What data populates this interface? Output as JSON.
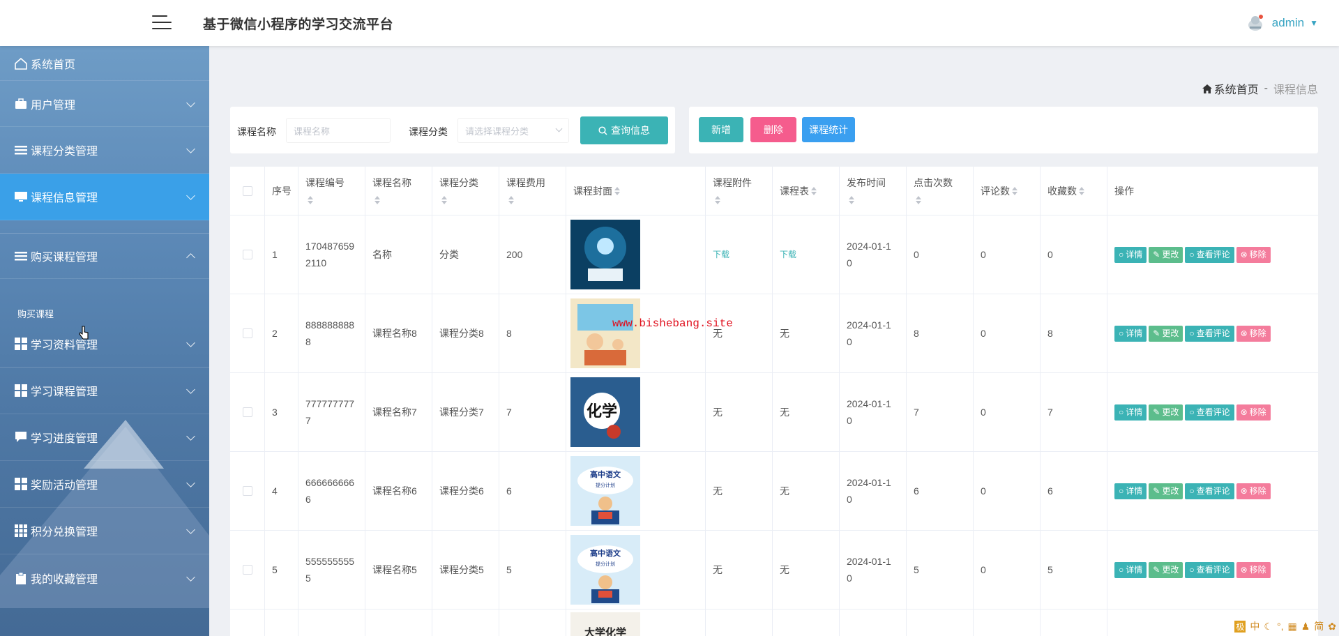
{
  "header": {
    "title": "基于微信小程序的学习交流平台",
    "username": "admin"
  },
  "sidebar": {
    "items": [
      {
        "label": "系统首页",
        "icon": "home-icon"
      },
      {
        "label": "用户管理",
        "icon": "briefcase-icon"
      },
      {
        "label": "课程分类管理",
        "icon": "list-icon"
      },
      {
        "label": "课程信息管理",
        "icon": "monitor-icon"
      },
      {
        "label": "购买课程管理",
        "icon": "list-icon"
      },
      {
        "label": "学习资料管理",
        "icon": "grid-icon"
      },
      {
        "label": "学习课程管理",
        "icon": "grid-icon"
      },
      {
        "label": "学习进度管理",
        "icon": "chat-icon"
      },
      {
        "label": "奖励活动管理",
        "icon": "grid-icon"
      },
      {
        "label": "积分兑换管理",
        "icon": "grid9-icon"
      },
      {
        "label": "我的收藏管理",
        "icon": "clipboard-icon"
      }
    ],
    "sub_item": "购买课程"
  },
  "breadcrumb": {
    "home": "系统首页",
    "separator": "-",
    "current": "课程信息"
  },
  "search": {
    "name_label": "课程名称",
    "name_placeholder": "课程名称",
    "category_label": "课程分类",
    "category_placeholder": "请选择课程分类",
    "button": "查询信息"
  },
  "actions": {
    "add": "新增",
    "delete": "删除",
    "stats": "课程统计"
  },
  "table": {
    "headers": [
      "序号",
      "课程编号",
      "课程名称",
      "课程分类",
      "课程费用",
      "课程封面",
      "课程附件",
      "课程表",
      "发布时间",
      "点击次数",
      "评论数",
      "收藏数",
      "操作"
    ],
    "rows": [
      {
        "idx": "1",
        "code1": "170487659",
        "code2": "2110",
        "name": "名称",
        "category": "分类",
        "fee": "200",
        "cover": "cover-1",
        "attachment": "下载",
        "schedule": "下载",
        "date1": "2024-01-1",
        "date2": "0",
        "clicks": "0",
        "comments": "0",
        "favorites": "0"
      },
      {
        "idx": "2",
        "code1": "888888888",
        "code2": "8",
        "name": "课程名称8",
        "category": "课程分类8",
        "fee": "8",
        "cover": "cover-2",
        "attachment": "无",
        "schedule": "无",
        "date1": "2024-01-1",
        "date2": "0",
        "clicks": "8",
        "comments": "0",
        "favorites": "8"
      },
      {
        "idx": "3",
        "code1": "777777777",
        "code2": "7",
        "name": "课程名称7",
        "category": "课程分类7",
        "fee": "7",
        "cover": "cover-3",
        "cover_text": "化学",
        "attachment": "无",
        "schedule": "无",
        "date1": "2024-01-1",
        "date2": "0",
        "clicks": "7",
        "comments": "0",
        "favorites": "7"
      },
      {
        "idx": "4",
        "code1": "666666666",
        "code2": "6",
        "name": "课程名称6",
        "category": "课程分类6",
        "fee": "6",
        "cover": "cover-4",
        "cover_text": "高中语文",
        "cover_sub": "提分计划",
        "attachment": "无",
        "schedule": "无",
        "date1": "2024-01-1",
        "date2": "0",
        "clicks": "6",
        "comments": "0",
        "favorites": "6"
      },
      {
        "idx": "5",
        "code1": "555555555",
        "code2": "5",
        "name": "课程名称5",
        "category": "课程分类5",
        "fee": "5",
        "cover": "cover-5",
        "cover_text": "高中语文",
        "cover_sub": "提分计划",
        "attachment": "无",
        "schedule": "无",
        "date1": "2024-01-1",
        "date2": "0",
        "clicks": "5",
        "comments": "0",
        "favorites": "5"
      }
    ],
    "partial_cover_text": "大学化学",
    "ops": {
      "detail": "详情",
      "edit": "更改",
      "comments": "查看评论",
      "remove": "移除"
    }
  },
  "watermark": "www.bishebang.site",
  "tray": {
    "ime": "中",
    "mode": "简"
  },
  "colors": {
    "teal": "#3bb3b5",
    "pink": "#f55c8d",
    "blue": "#3a9ff0",
    "active_menu": "#3aa0e8"
  }
}
